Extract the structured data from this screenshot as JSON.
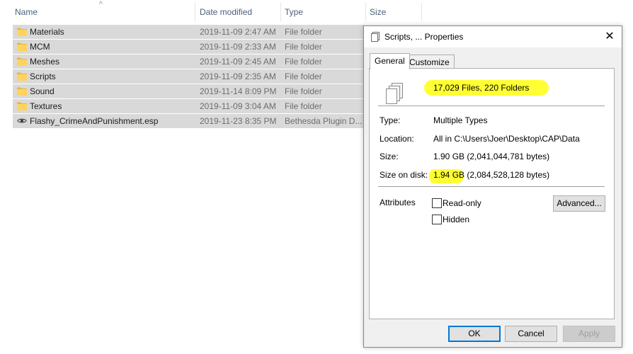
{
  "explorer": {
    "columns": {
      "name": "Name",
      "date_modified": "Date modified",
      "type": "Type",
      "size": "Size"
    },
    "rows": [
      {
        "name": "Materials",
        "date": "2019-11-09 2:47 AM",
        "type": "File folder",
        "icon": "folder-icon"
      },
      {
        "name": "MCM",
        "date": "2019-11-09 2:33 AM",
        "type": "File folder",
        "icon": "folder-icon"
      },
      {
        "name": "Meshes",
        "date": "2019-11-09 2:45 AM",
        "type": "File folder",
        "icon": "folder-icon"
      },
      {
        "name": "Scripts",
        "date": "2019-11-09 2:35 AM",
        "type": "File folder",
        "icon": "folder-icon"
      },
      {
        "name": "Sound",
        "date": "2019-11-14 8:09 PM",
        "type": "File folder",
        "icon": "folder-icon"
      },
      {
        "name": "Textures",
        "date": "2019-11-09 3:04 AM",
        "type": "File folder",
        "icon": "folder-icon"
      },
      {
        "name": "Flashy_CrimeAndPunishment.esp",
        "date": "2019-11-23 8:35 PM",
        "type": "Bethesda Plugin D...",
        "icon": "esp-file-icon"
      }
    ]
  },
  "dialog": {
    "title": "Scripts, ... Properties",
    "close_glyph": "✕",
    "tabs": {
      "general": "General",
      "customize": "Customize"
    },
    "summary": "17,029 Files, 220 Folders",
    "type_label": "Type:",
    "type_value": "Multiple Types",
    "location_label": "Location:",
    "location_value": "All in C:\\Users\\Joer\\Desktop\\CAP\\Data",
    "size_label": "Size:",
    "size_value": "1.90 GB (2,041,044,781 bytes)",
    "size_on_disk_label": "Size on disk:",
    "size_on_disk_highlight": "1.94 GB",
    "size_on_disk_rest": " (2,084,528,128 bytes)",
    "attributes_label": "Attributes",
    "readonly_label": "Read-only",
    "hidden_label": "Hidden",
    "advanced_button": "Advanced...",
    "ok_button": "OK",
    "cancel_button": "Cancel",
    "apply_button": "Apply"
  },
  "colors": {
    "selection": "#d9d9d9",
    "highlight": "#ffff33",
    "accent": "#0078d7",
    "folder": "#ffd35e"
  }
}
